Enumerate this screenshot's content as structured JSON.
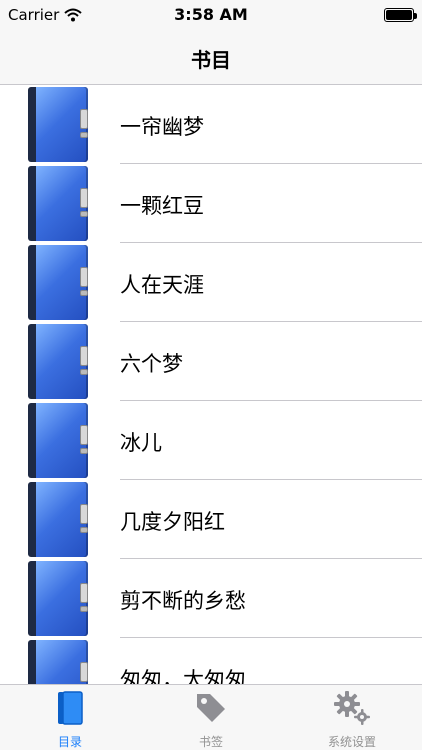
{
  "status": {
    "carrier": "Carrier",
    "time": "3:58 AM"
  },
  "nav": {
    "title": "书目"
  },
  "books": [
    {
      "title": "一帘幽梦"
    },
    {
      "title": "一颗红豆"
    },
    {
      "title": "人在天涯"
    },
    {
      "title": "六个梦"
    },
    {
      "title": "冰儿"
    },
    {
      "title": "几度夕阳红"
    },
    {
      "title": "剪不断的乡愁"
    },
    {
      "title": "匆匆，太匆匆"
    }
  ],
  "tabs": [
    {
      "label": "目录",
      "icon": "book-icon",
      "active": true
    },
    {
      "label": "书签",
      "icon": "tag-icon",
      "active": false
    },
    {
      "label": "系统设置",
      "icon": "gear-icon",
      "active": false
    }
  ],
  "colors": {
    "accent": "#1b7ffa",
    "inactive": "#929292",
    "book_blue": "#3b6fe0"
  }
}
